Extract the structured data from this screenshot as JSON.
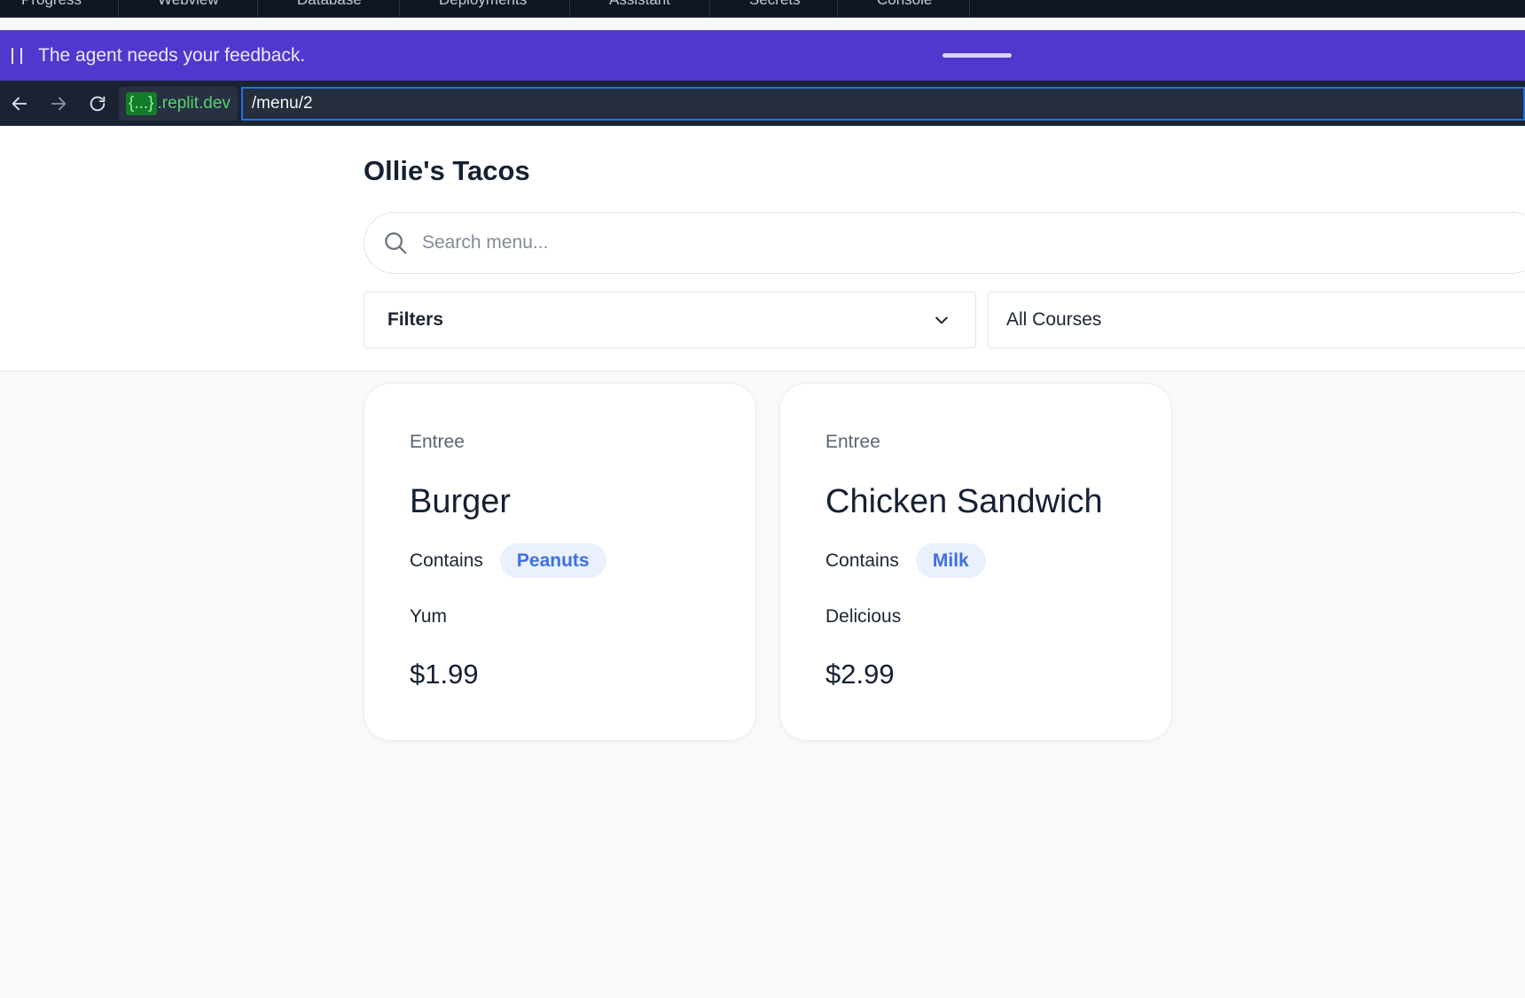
{
  "tabs": [
    {
      "label": "Progress",
      "icon": "list-icon"
    },
    {
      "label": "Webview",
      "icon": "globe-icon"
    },
    {
      "label": "Database",
      "icon": "database-icon"
    },
    {
      "label": "Deployments",
      "icon": "rocket-icon"
    },
    {
      "label": "Assistant",
      "icon": "assistant-icon"
    },
    {
      "label": "Secrets",
      "icon": "lock-icon"
    },
    {
      "label": "Console",
      "icon": "terminal-icon"
    }
  ],
  "banner": {
    "message": "The agent needs your feedback.",
    "color": "#5038cf"
  },
  "addressbar": {
    "domain_variable": "{...}",
    "domain_suffix": ".replit.dev",
    "path": "/menu/2"
  },
  "page": {
    "title": "Ollie's Tacos",
    "search": {
      "placeholder": "Search menu...",
      "value": ""
    },
    "filters_label": "Filters",
    "course_select": "All Courses"
  },
  "menu_items": [
    {
      "course": "Entree",
      "name": "Burger",
      "contains_label": "Contains",
      "allergen": "Peanuts",
      "description": "Yum",
      "price": "$1.99"
    },
    {
      "course": "Entree",
      "name": "Chicken Sandwich",
      "contains_label": "Contains",
      "allergen": "Milk",
      "description": "Delicious",
      "price": "$2.99"
    }
  ],
  "colors": {
    "accent_blue": "#3f6fe0",
    "badge_bg": "#eaf0fd",
    "url_focus": "#1f74e0",
    "domain_green": "#55d26b"
  }
}
